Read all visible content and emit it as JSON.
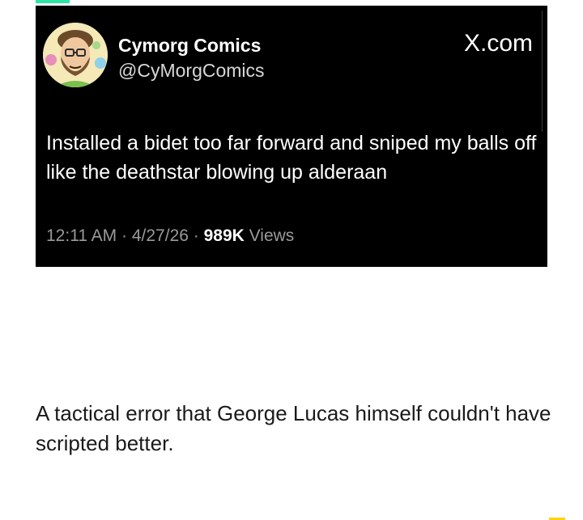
{
  "tweet": {
    "author_name": "Cymorg Comics",
    "author_handle": "@CyMorgComics",
    "brand": "X.com",
    "text": "Installed a bidet too far forward and sniped my balls off like the deathstar blowing up alderaan",
    "time": "12:11 AM",
    "separator": "·",
    "date": "4/27/26",
    "views_count": "989K",
    "views_label": "Views"
  },
  "caption": "A tactical error that George Lucas himself couldn't have scripted better.",
  "colors": {
    "card_background": "#000000",
    "page_background": "#ffffff",
    "top_accent": "#2ee6a6",
    "bottom_accent": "#ffd400"
  },
  "icons": {
    "avatar": "cartoon-bearded-man-avatar"
  }
}
